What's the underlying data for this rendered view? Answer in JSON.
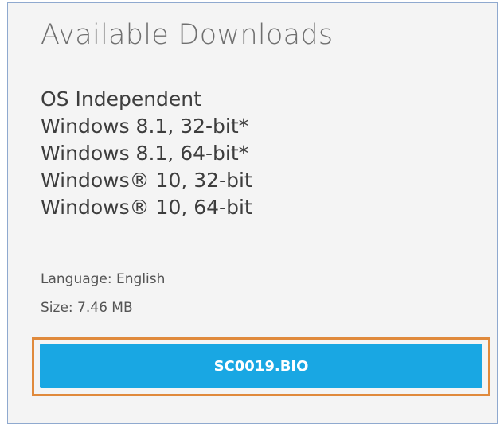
{
  "header": {
    "title": "Available Downloads"
  },
  "downloads": {
    "os_list": [
      "OS Independent",
      "Windows 8.1, 32-bit*",
      "Windows 8.1, 64-bit*",
      "Windows® 10, 32-bit",
      "Windows® 10, 64-bit"
    ],
    "language": "Language: English",
    "size": "Size: 7.46 MB",
    "button_label": "SC0019.BIO"
  },
  "colors": {
    "panel_background": "#f4f4f4",
    "panel_border": "#8fa9cf",
    "button_background": "#19a7e3",
    "highlight_border": "#e08a3c"
  }
}
